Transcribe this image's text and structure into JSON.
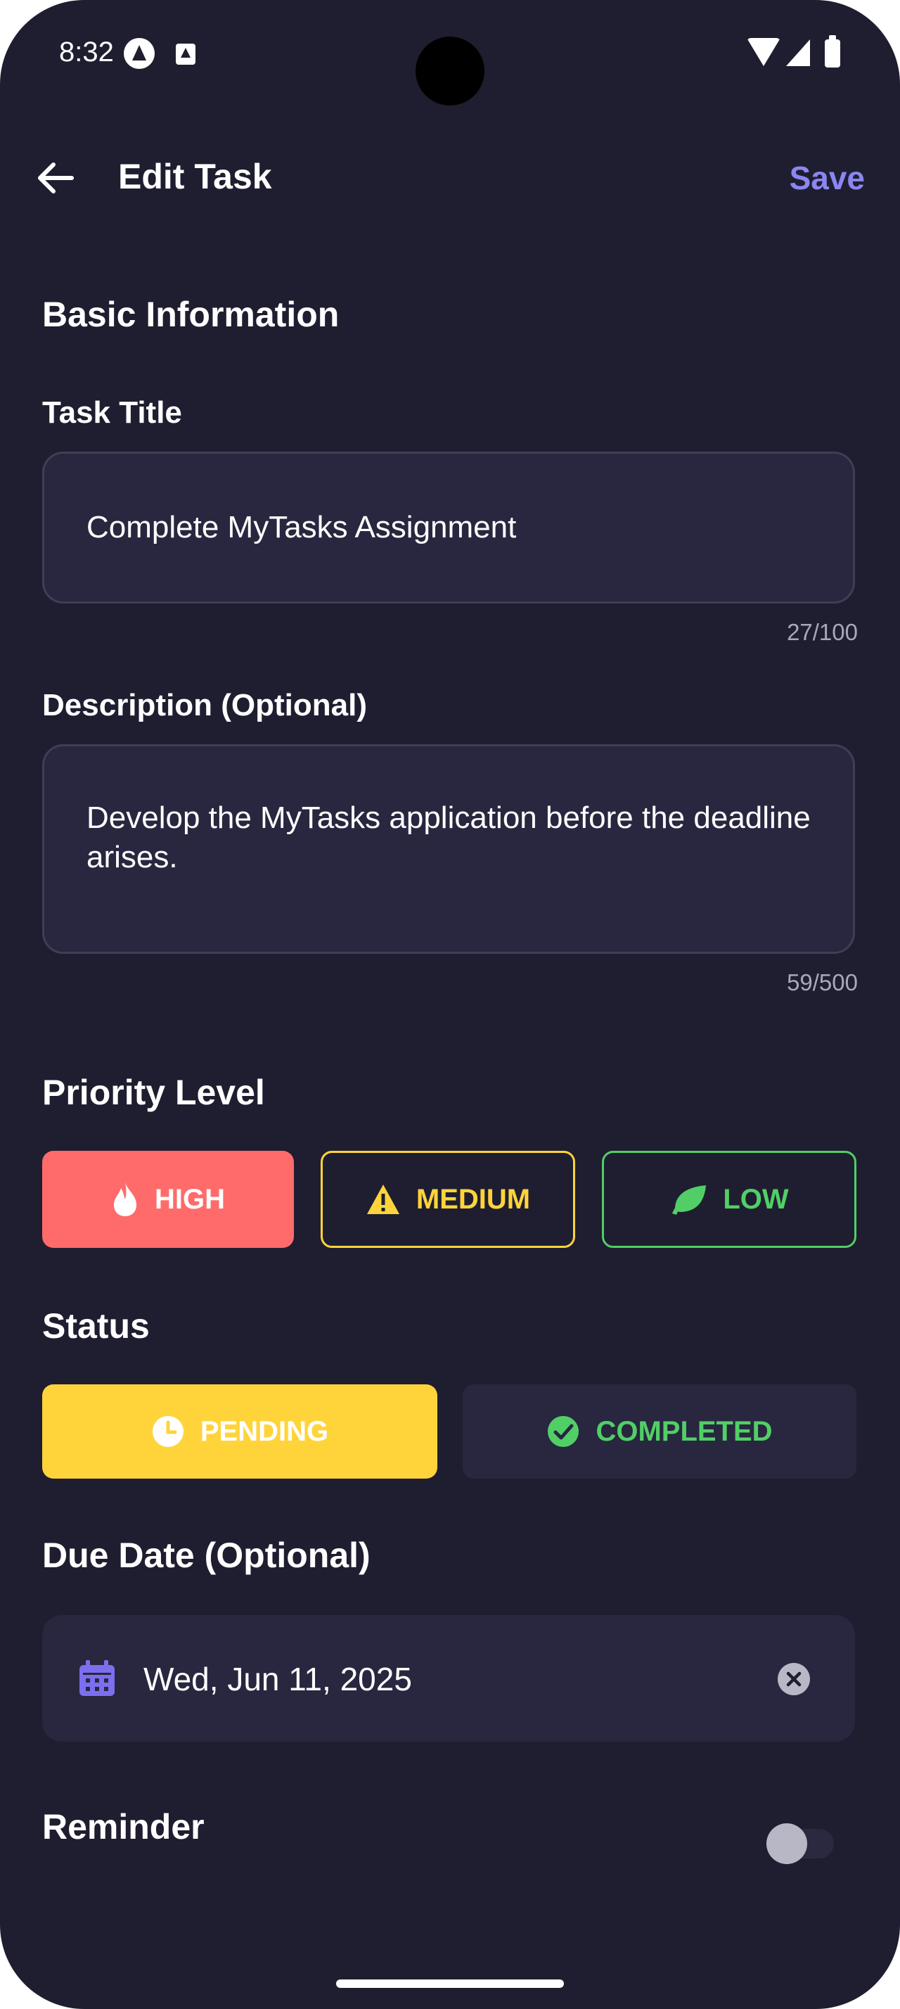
{
  "status_bar": {
    "time": "8:32"
  },
  "header": {
    "title": "Edit Task",
    "save_label": "Save"
  },
  "basic_info": {
    "heading": "Basic Information",
    "title_label": "Task Title",
    "title_value": "Complete MyTasks Assignment",
    "title_counter": "27/100",
    "description_label": "Description (Optional)",
    "description_value": "Develop the MyTasks application before the deadline arises.",
    "description_counter": "59/500"
  },
  "priority": {
    "heading": "Priority Level",
    "options": [
      {
        "label": "HIGH",
        "icon": "flame-icon",
        "color": "#ff6b6b",
        "selected": true
      },
      {
        "label": "MEDIUM",
        "icon": "warning-icon",
        "color": "#ffd43b",
        "selected": false
      },
      {
        "label": "LOW",
        "icon": "leaf-icon",
        "color": "#51cf66",
        "selected": false
      }
    ]
  },
  "status": {
    "heading": "Status",
    "options": [
      {
        "label": "PENDING",
        "icon": "clock-icon",
        "color": "#ffd43b",
        "selected": true
      },
      {
        "label": "COMPLETED",
        "icon": "check-circle-icon",
        "color": "#51cf66",
        "selected": false
      }
    ]
  },
  "due_date": {
    "heading": "Due Date (Optional)",
    "value": "Wed, Jun 11, 2025",
    "icon": "calendar-icon"
  },
  "reminder": {
    "label": "Reminder",
    "enabled": false
  },
  "colors": {
    "background": "#1f1e30",
    "surface": "#28273f",
    "accent": "#8b86f0"
  }
}
